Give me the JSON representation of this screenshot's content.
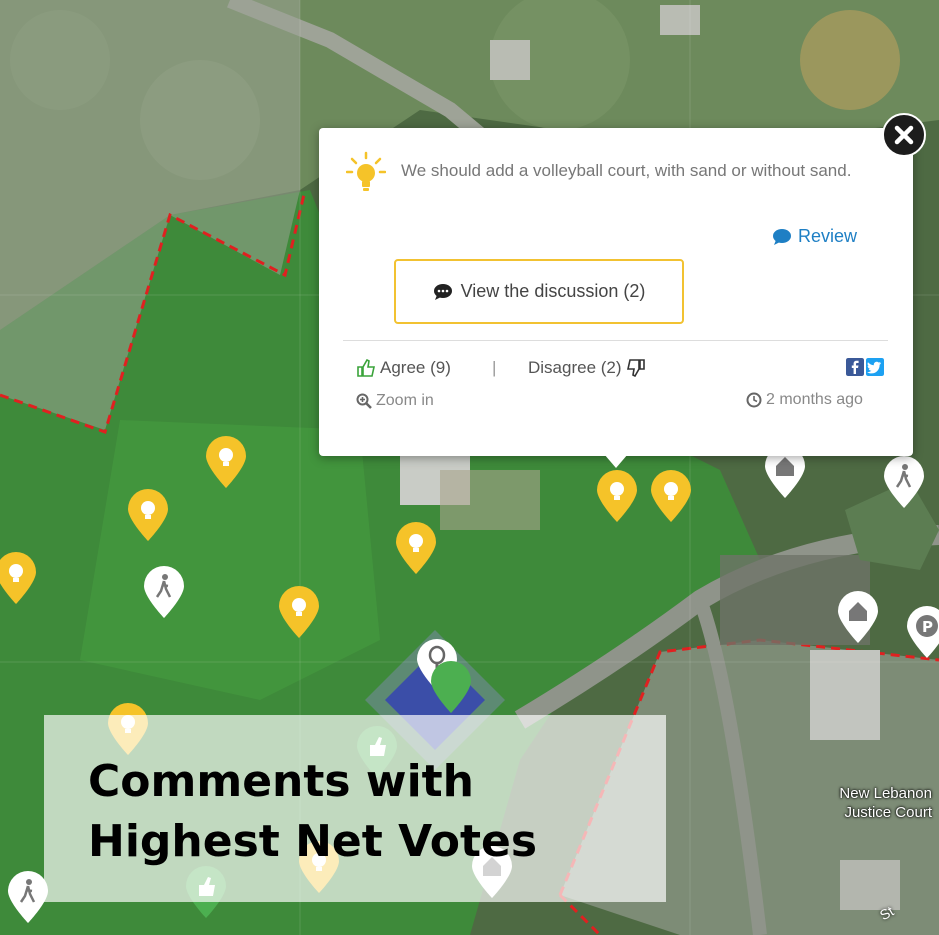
{
  "map": {
    "place_label": "New Lebanon Justice Court",
    "road_label": "St",
    "boundary_color": "#e02020",
    "idea_marker_color": "#f5c329",
    "upvote_marker_color": "#4caf50"
  },
  "popup": {
    "icon": "lightbulb-icon",
    "comment": "We should add a volleyball court, with sand or without sand.",
    "review_label": "Review",
    "discussion_label": "View the discussion (2)",
    "agree_label": "Agree (9)",
    "separator": "|",
    "disagree_label": "Disagree (2)",
    "zoom_label": "Zoom in",
    "timestamp": "2 months ago",
    "share": [
      "facebook-icon",
      "twitter-icon"
    ],
    "share_colors": {
      "facebook": "#3b5998",
      "twitter": "#1da1f2"
    }
  },
  "caption": {
    "line1": "Comments with",
    "line2": "Highest Net Votes"
  }
}
